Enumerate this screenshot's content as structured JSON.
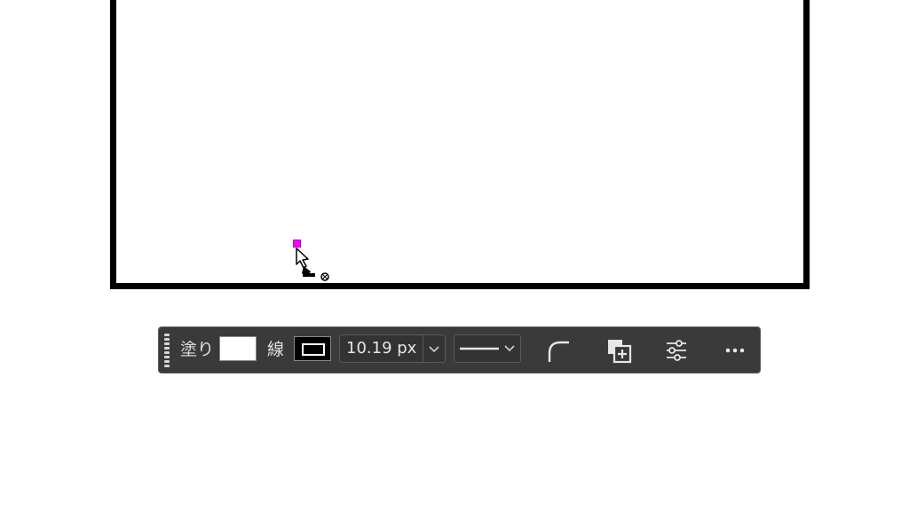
{
  "canvas": {
    "stroke_color": "#000000",
    "anchor_color": "#ff00ff"
  },
  "cursor": {
    "icon": "pen-tool-cursor-icon"
  },
  "toolbar": {
    "fill_label": "塗り",
    "fill_color": "#ffffff",
    "stroke_label": "線",
    "stroke_color": "#000000",
    "stroke_width": "10.19 px",
    "stroke_style": "solid",
    "icons": {
      "grip": "drag-handle-icon",
      "width_dropdown": "chevron-down-icon",
      "style_dropdown": "chevron-down-icon",
      "corner": "corner-radius-icon",
      "combine": "path-combine-icon",
      "options": "sliders-icon",
      "more": "more-icon"
    },
    "background_color": "#3a3a3a"
  }
}
